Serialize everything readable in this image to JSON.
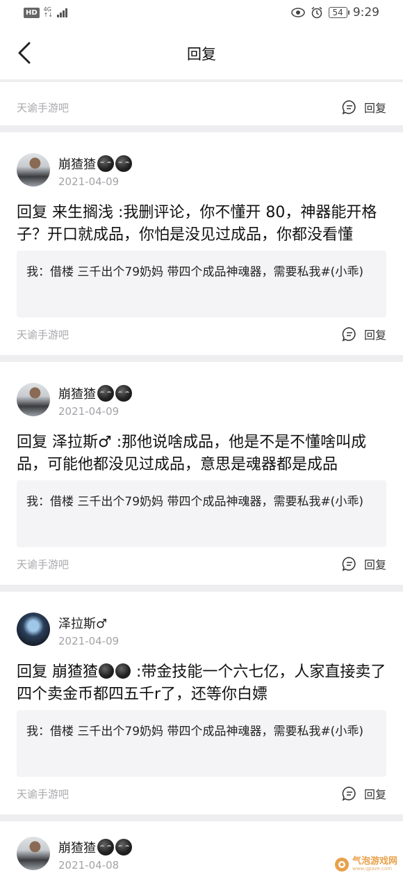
{
  "status_bar": {
    "network_badge": "HD",
    "network_type": "4G",
    "battery": "54",
    "time": "9:29"
  },
  "nav": {
    "title": "回复"
  },
  "first_card": {
    "forum": "天谕手游吧",
    "reply_label": "回复"
  },
  "posts": [
    {
      "username": "崩猹猹",
      "date": "2021-04-09",
      "text": "回复 来生搁浅 :我删评论，你不懂开 80，神器能开格子？开口就成品，你怕是没见过成品，你都没看懂",
      "quote": "我：借楼 三千出个79奶妈 带四个成品神魂器，需要私我#(小乖)",
      "forum": "天谕手游吧",
      "reply_label": "回复"
    },
    {
      "username": "崩猹猹",
      "date": "2021-04-09",
      "text": "回复 泽拉斯♂ :那他说啥成品，他是不是不懂啥叫成品，可能他都没见过成品，意思是魂器都是成品",
      "quote": "我：借楼 三千出个79奶妈 带四个成品神魂器，需要私我#(小乖)",
      "forum": "天谕手游吧",
      "reply_label": "回复"
    },
    {
      "username": "泽拉斯♂",
      "date": "2021-04-09",
      "text_prefix": "回复 崩猹猹",
      "text_suffix": " :带金技能一个六七亿，人家直接卖了四个卖金币都四五千r了，还等你白嫖",
      "quote": "我：借楼 三千出个79奶妈 带四个成品神魂器，需要私我#(小乖)",
      "forum": "天谕手游吧",
      "reply_label": "回复"
    },
    {
      "username": "崩猹猹",
      "date": "2021-04-08"
    }
  ],
  "watermark": {
    "name": "气泡游戏网",
    "url": "www.qpaze.com"
  }
}
